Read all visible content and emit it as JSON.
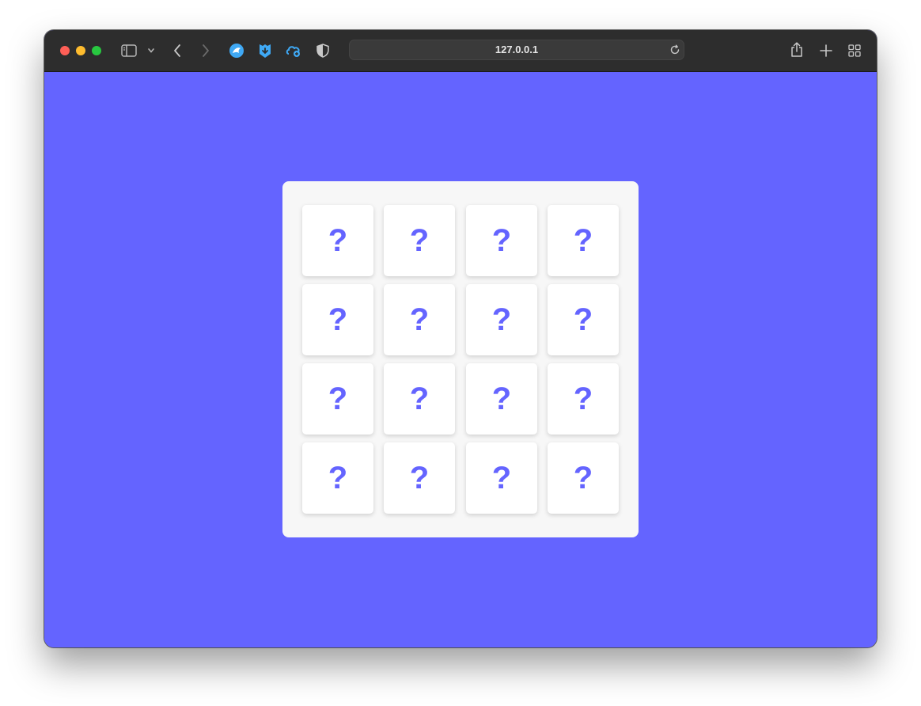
{
  "browser": {
    "url": "127.0.0.1",
    "icons": [
      "sidebar-icon",
      "chevron-down-icon",
      "back-icon",
      "forward-icon",
      "extension-bird-icon",
      "extension-shield-icon",
      "extension-cloud-icon",
      "privacy-shield-icon",
      "reload-icon",
      "share-icon",
      "new-tab-icon",
      "tab-overview-icon"
    ]
  },
  "page": {
    "background_color": "#6464ff",
    "board_color": "#f7f7f7",
    "card_color": "#ffffff",
    "accent_color": "#6464ff"
  },
  "board": {
    "cards": [
      {
        "label": "?"
      },
      {
        "label": "?"
      },
      {
        "label": "?"
      },
      {
        "label": "?"
      },
      {
        "label": "?"
      },
      {
        "label": "?"
      },
      {
        "label": "?"
      },
      {
        "label": "?"
      },
      {
        "label": "?"
      },
      {
        "label": "?"
      },
      {
        "label": "?"
      },
      {
        "label": "?"
      },
      {
        "label": "?"
      },
      {
        "label": "?"
      },
      {
        "label": "?"
      },
      {
        "label": "?"
      }
    ]
  }
}
